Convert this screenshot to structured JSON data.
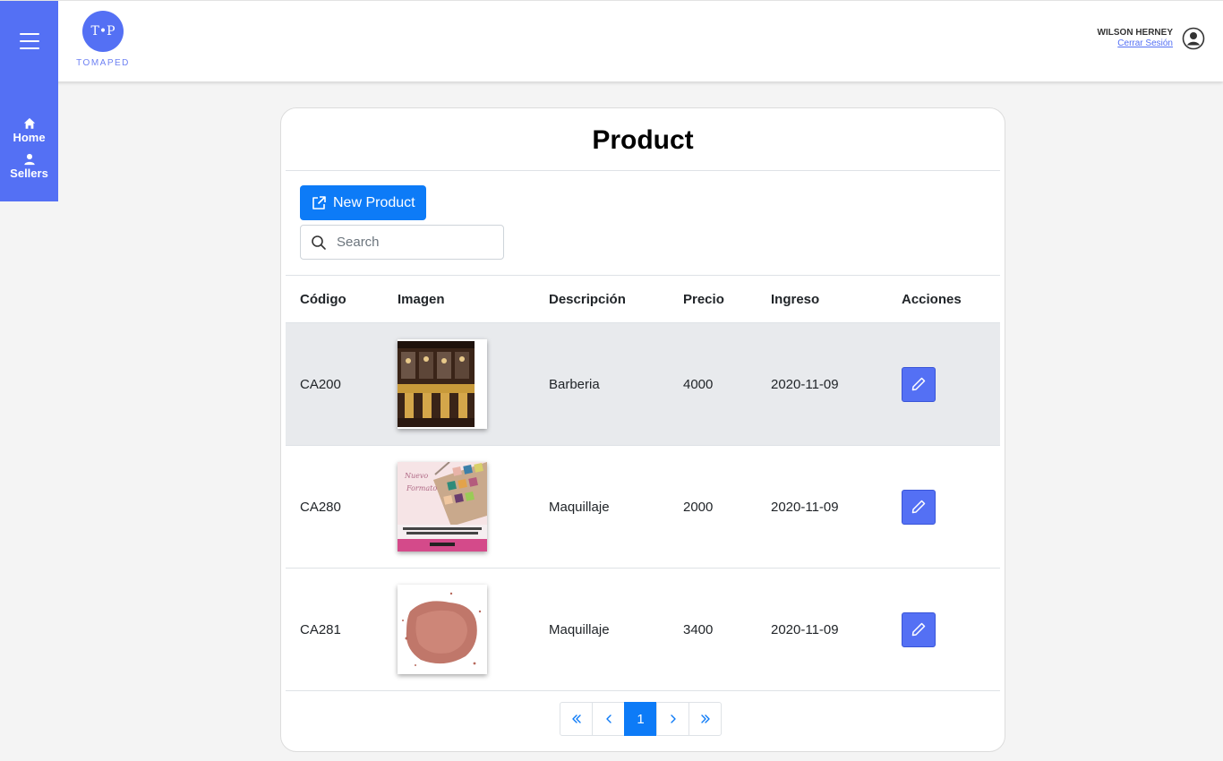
{
  "header": {
    "logo_mark": "T•P",
    "logo_text": "TOMAPED",
    "user_name": "WILSON HERNEY",
    "logout_label": "Cerrar Sesión"
  },
  "sidebar": {
    "items": [
      {
        "label": "Home",
        "icon": "home-icon"
      },
      {
        "label": "Sellers",
        "icon": "user-icon"
      }
    ]
  },
  "main": {
    "title": "Product",
    "new_button_label": "New Product",
    "search_placeholder": "Search",
    "columns": [
      "Código",
      "Imagen",
      "Descripción",
      "Precio",
      "Ingreso",
      "Acciones"
    ],
    "rows": [
      {
        "code": "CA200",
        "description": "Barberia",
        "price": "4000",
        "date": "2020-11-09",
        "image": "barbershop-photo"
      },
      {
        "code": "CA280",
        "description": "Maquillaje",
        "price": "2000",
        "date": "2020-11-09",
        "image": "eyeshadow-palette-photo"
      },
      {
        "code": "CA281",
        "description": "Maquillaje",
        "price": "3400",
        "date": "2020-11-09",
        "image": "blush-powder-photo"
      }
    ],
    "pagination": {
      "current_page": "1"
    }
  },
  "colors": {
    "brand": "#5470f4",
    "primary": "#0d7bf7",
    "highlight_row": "#e8eaed"
  }
}
